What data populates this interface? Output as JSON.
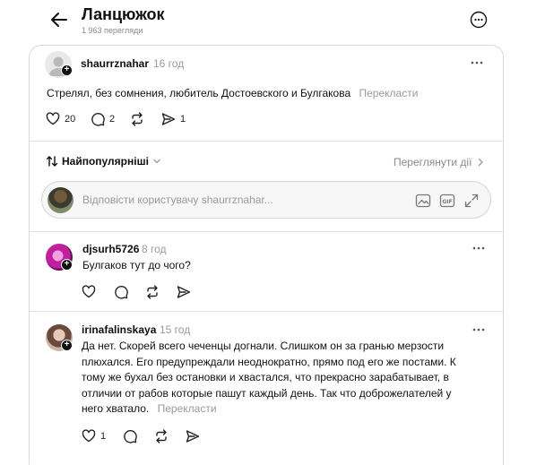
{
  "header": {
    "title": "Ланцюжок",
    "views": "1 963 перегляди"
  },
  "post": {
    "username": "shaurrznahar",
    "time": "16 год",
    "text": "Стрелял, без сомнения, любитель Достоевского и Булгакова",
    "translate": "Перекласти",
    "likes": "20",
    "comments": "2",
    "shares": "1"
  },
  "sort": {
    "label": "Найпопулярніші",
    "view_activity": "Переглянути дії"
  },
  "reply_box": {
    "placeholder": "Відповісти користувачу shaurrznahar..."
  },
  "replies": [
    {
      "username": "djsurh5726",
      "time": "8 год",
      "lines": [
        "Булгаков тут до чого?"
      ]
    },
    {
      "username": "irinafalinskaya",
      "time": "15 год",
      "lines": [
        "Да нет. Скорей всего чеченцы догнали. Слишком он за гранью мерзости",
        "плюхался. Его предупреждали неоднократно, прямо под его же постами. К",
        "тому же бухал без остановки и хвастался, что прекрасно зарабатывает, в",
        "отличии от рабов которые пашут каждый день. Так что доброжелателей у",
        "него хватало."
      ],
      "translate": "Перекласти",
      "likes": "1"
    }
  ],
  "icons": {
    "back": "arrow-left-icon",
    "more": "more-circle-icon",
    "like": "heart-icon",
    "comment": "comment-bubble-icon",
    "repost": "repost-icon",
    "share": "send-icon",
    "sort": "sort-arrows-icon",
    "gif": "gif-icon",
    "image": "image-icon",
    "expand": "expand-icon"
  }
}
